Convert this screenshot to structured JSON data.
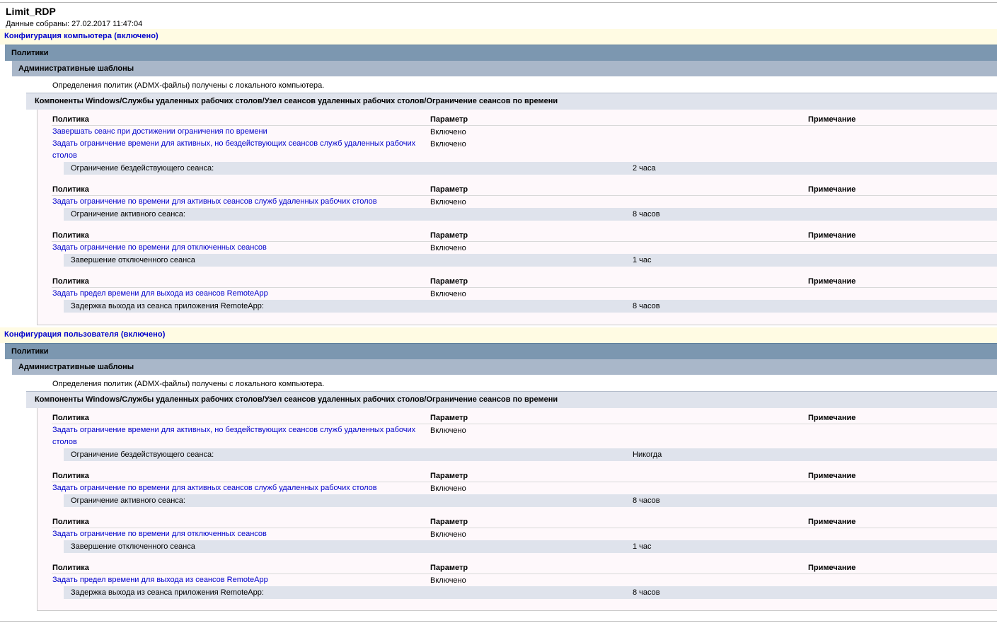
{
  "report": {
    "title": "Limit_RDP",
    "collected": "Данные собраны: 27.02.2017 11:47:04"
  },
  "labels": {
    "policies": "Политики",
    "admin_templates": "Административные шаблоны",
    "definitions": "Определения политик (ADMX-файлы) получены с локального компьютера.",
    "component_path": "Компоненты Windows/Службы удаленных рабочих столов/Узел сеансов удаленных рабочих столов/Ограничение сеансов по времени",
    "col_policy": "Политика",
    "col_setting": "Параметр",
    "col_comment": "Примечание"
  },
  "computer": {
    "header": "Конфигурация компьютера (включено)",
    "policies": [
      {
        "name": "Завершать сеанс при достижении ограничения по времени",
        "value": "Включено"
      },
      {
        "name": "Задать ограничение времени для активных, но бездействующих сеансов служб удаленных рабочих столов",
        "value": "Включено",
        "sub_label": "Ограничение бездействующего сеанса:",
        "sub_value": "2 часа"
      },
      {
        "name": "Задать ограничение по времени для активных сеансов служб удаленных рабочих столов",
        "value": "Включено",
        "sub_label": "Ограничение активного сеанса:",
        "sub_value": "8 часов"
      },
      {
        "name": "Задать ограничение по времени для отключенных сеансов",
        "value": "Включено",
        "sub_label": "Завершение отключенного сеанса",
        "sub_value": "1 час"
      },
      {
        "name": "Задать предел времени для выхода из сеансов RemoteApp",
        "value": "Включено",
        "sub_label": "Задержка выхода из сеанса приложения RemoteApp:",
        "sub_value": "8 часов"
      }
    ]
  },
  "user": {
    "header": "Конфигурация пользователя (включено)",
    "policies": [
      {
        "name": "Задать ограничение времени для активных, но бездействующих сеансов служб удаленных рабочих столов",
        "value": "Включено",
        "sub_label": "Ограничение бездействующего сеанса:",
        "sub_value": "Никогда"
      },
      {
        "name": "Задать ограничение по времени для активных сеансов служб удаленных рабочих столов",
        "value": "Включено",
        "sub_label": "Ограничение активного сеанса:",
        "sub_value": "8 часов"
      },
      {
        "name": "Задать ограничение по времени для отключенных сеансов",
        "value": "Включено",
        "sub_label": "Завершение отключенного сеанса",
        "sub_value": "1 час"
      },
      {
        "name": "Задать предел времени для выхода из сеансов RemoteApp",
        "value": "Включено",
        "sub_label": "Задержка выхода из сеанса приложения RemoteApp:",
        "sub_value": "8 часов"
      }
    ]
  }
}
